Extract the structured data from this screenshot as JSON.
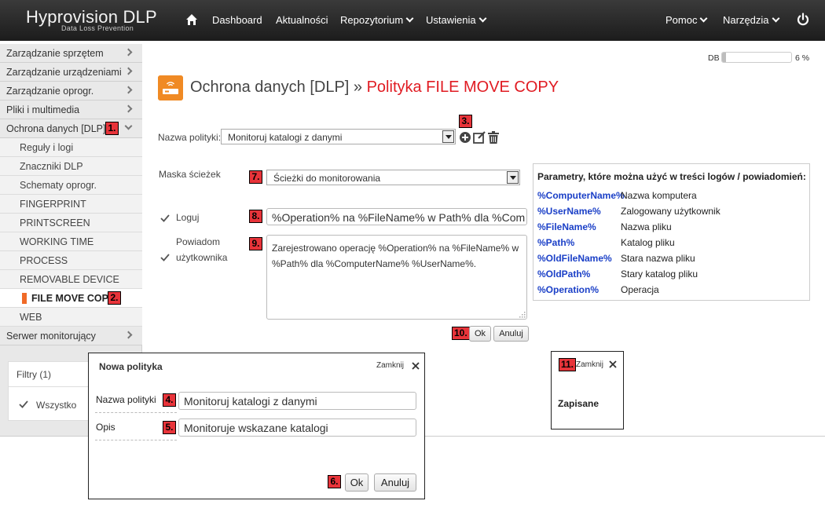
{
  "app": {
    "name": "Hyprovision DLP",
    "subtitle": "Data Loss Prevention"
  },
  "topnav": {
    "items": [
      {
        "label": "Dashboard"
      },
      {
        "label": "Aktualności"
      },
      {
        "label": "Repozytorium"
      },
      {
        "label": "Ustawienia"
      }
    ],
    "right": [
      {
        "label": "Pomoc"
      },
      {
        "label": "Narzędzia"
      }
    ],
    "icons": {
      "home": "home-icon",
      "power": "power-icon"
    }
  },
  "sidebar": {
    "items": [
      {
        "label": "Zarządzanie sprzętem"
      },
      {
        "label": "Zarządzanie urządzeniami"
      },
      {
        "label": "Zarządzanie oprogr."
      },
      {
        "label": "Pliki i multimedia"
      },
      {
        "label": "Ochrona danych [DLP]"
      }
    ],
    "subitems": [
      {
        "label": "Reguły i logi"
      },
      {
        "label": "Znaczniki DLP"
      },
      {
        "label": "Schematy oprogr."
      },
      {
        "label": "FINGERPRINT"
      },
      {
        "label": "PRINTSCREEN"
      },
      {
        "label": "WORKING TIME"
      },
      {
        "label": "PROCESS"
      },
      {
        "label": "REMOVABLE DEVICE"
      },
      {
        "label": "FILE MOVE COPY"
      },
      {
        "label": "WEB"
      }
    ],
    "server": {
      "label": "Serwer monitorujący"
    },
    "filters": {
      "title": "Filtry (1)",
      "option": "Wszystko"
    }
  },
  "db_usage": {
    "label": "DB",
    "percent_text": "6 %",
    "percent": 6
  },
  "page": {
    "title_section": "Ochrona danych [DLP]",
    "title_sep": "»",
    "title_policy": "Polityka FILE MOVE COPY"
  },
  "form": {
    "policy_label": "Nazwa polityki:",
    "policy_value": "Monitoruj katalogi z danymi",
    "mask_label": "Maska ścieżek",
    "mask_value": "Ścieżki do monitorowania",
    "log_label": "Loguj",
    "log_value": "%Operation% na %FileName% w Path% dla %Com",
    "notify_label_1": "Powiadom",
    "notify_label_2": "użytkownika",
    "notify_value": "Zarejestrowano operację %Operation% na %FileName% w %Path% dla %ComputerName% %UserName%.",
    "ok": "Ok",
    "cancel": "Anuluj"
  },
  "params": {
    "title": "Parametry, które można użyć w treści logów / powiadomień:",
    "rows": [
      {
        "key": "%ComputerName%",
        "desc": "Nazwa komputera"
      },
      {
        "key": "%UserName%",
        "desc": "Zalogowany użytkownik"
      },
      {
        "key": "%FileName%",
        "desc": "Nazwa pliku"
      },
      {
        "key": "%Path%",
        "desc": "Katalog pliku"
      },
      {
        "key": "%OldFileName%",
        "desc": "Stara nazwa pliku"
      },
      {
        "key": "%OldPath%",
        "desc": "Stary katalog pliku"
      },
      {
        "key": "%Operation%",
        "desc": "Operacja"
      }
    ]
  },
  "dialog_new_policy": {
    "title": "Nowa polityka",
    "close": "Zamknij",
    "name_label": "Nazwa polityki",
    "name_value": "Monitoruj katalogi z danymi",
    "desc_label": "Opis",
    "desc_value": "Monitoruje wskazane katalogi",
    "ok": "Ok",
    "cancel": "Anuluj"
  },
  "dialog_saved": {
    "close": "Zamknij",
    "message": "Zapisane"
  },
  "badges": [
    "1.",
    "2.",
    "3.",
    "4.",
    "5.",
    "6.",
    "7.",
    "8.",
    "9.",
    "10.",
    "11."
  ]
}
